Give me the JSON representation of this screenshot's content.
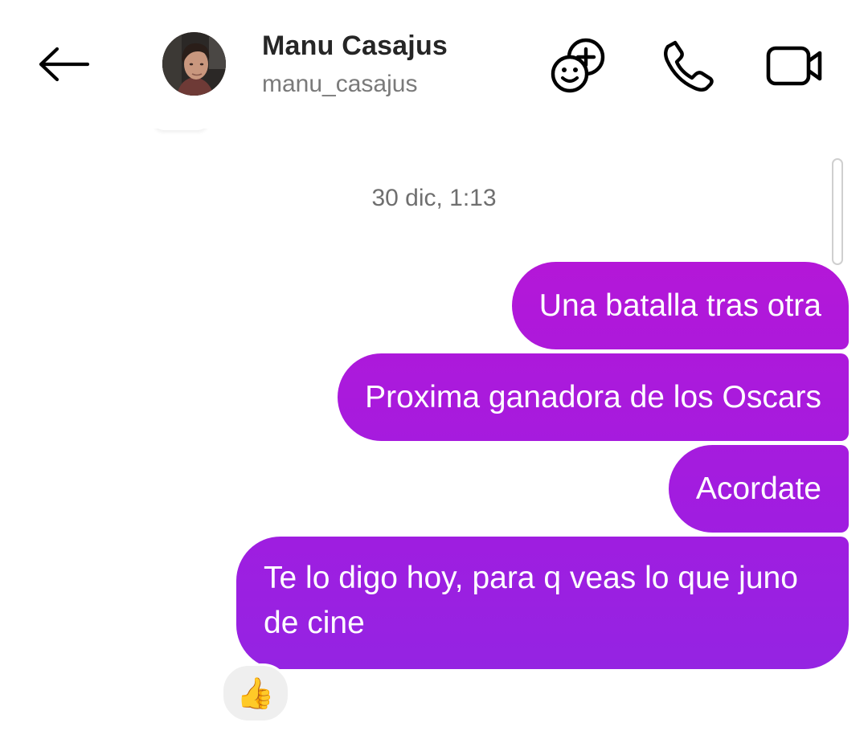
{
  "header": {
    "back_icon": "arrow-left-icon",
    "name": "Manu Casajus",
    "handle": "manu_casajus",
    "add_people_icon": "add-friend-emoji-icon",
    "call_icon": "phone-icon",
    "video_icon": "video-camera-icon"
  },
  "conversation": {
    "timestamp": "30 dic, 1:13",
    "messages": [
      {
        "text": "Una batalla tras otra",
        "sender": "me"
      },
      {
        "text": "Proxima ganadora de los Oscars",
        "sender": "me"
      },
      {
        "text": "Acordate",
        "sender": "me"
      },
      {
        "text": "Te lo digo hoy, para q veas lo que juno de cine",
        "sender": "me"
      }
    ],
    "reaction": "👍",
    "bubble_color": "#b417d8"
  }
}
